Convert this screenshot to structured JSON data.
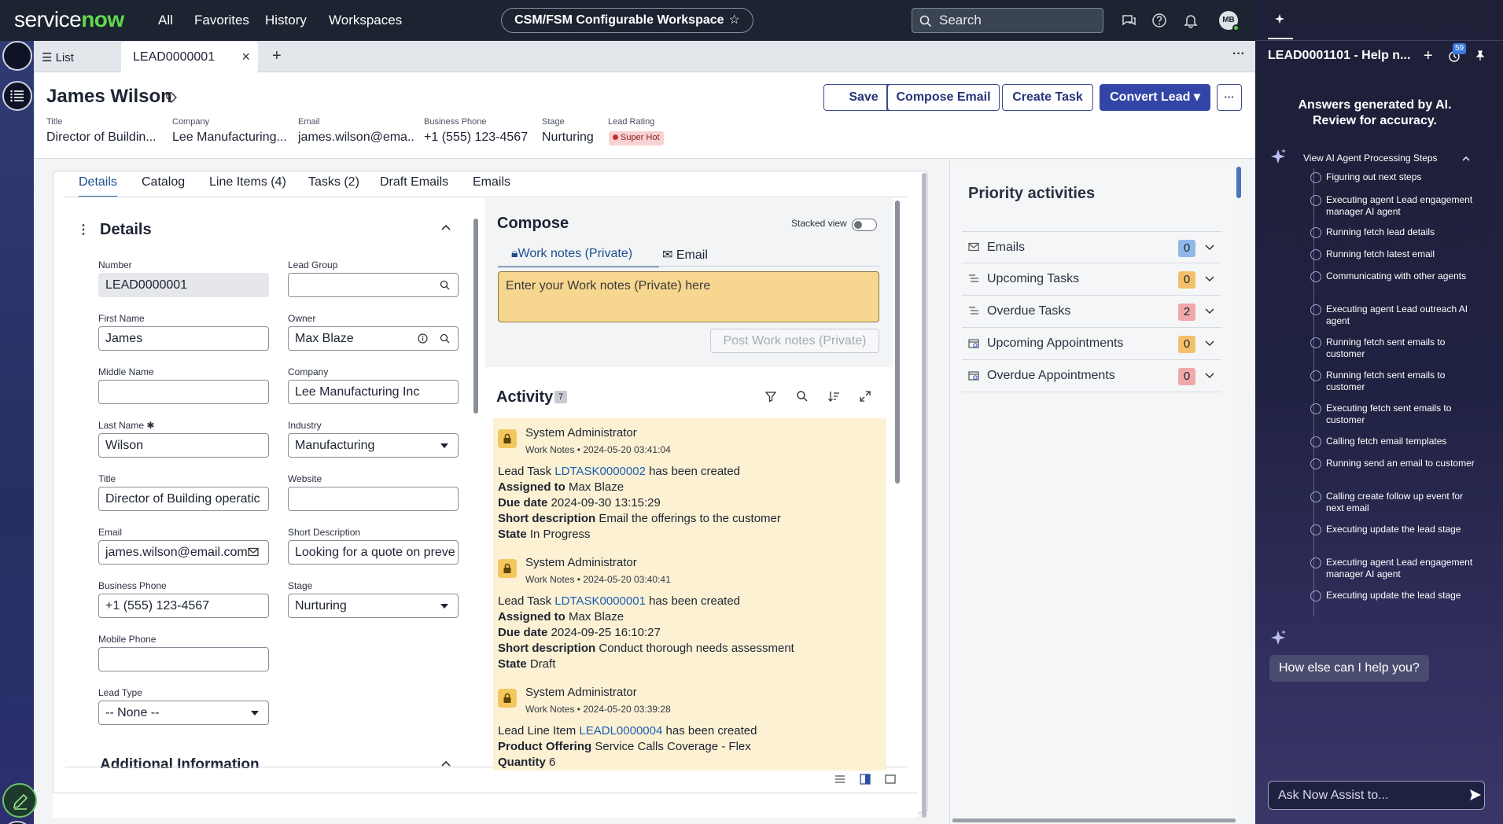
{
  "topnav": {
    "logo_a": "service",
    "logo_b": "now",
    "links": [
      "All",
      "Favorites",
      "History",
      "Workspaces"
    ],
    "workspace": "CSM/FSM Configurable Workspace",
    "search_placeholder": "Search",
    "avatar": "MB"
  },
  "tabs": {
    "list_label": "List",
    "active_tab": "LEAD0000001",
    "close": "×",
    "add": "+"
  },
  "record": {
    "name": "James Wilson",
    "fields": [
      {
        "label": "Title",
        "value": "Director of Buildin..."
      },
      {
        "label": "Company",
        "value": "Lee Manufacturing..."
      },
      {
        "label": "Email",
        "value": "james.wilson@ema..."
      },
      {
        "label": "Business Phone",
        "value": "+1 (555) 123-4567"
      },
      {
        "label": "Stage",
        "value": "Nurturing"
      },
      {
        "label": "Lead Rating",
        "value": "Super Hot"
      }
    ],
    "buttons": {
      "save": "Save",
      "compose": "Compose Email",
      "task": "Create Task",
      "convert": "Convert Lead",
      "more": "···"
    }
  },
  "subtabs": [
    "Details",
    "Catalog",
    "Line Items (4)",
    "Tasks (2)",
    "Draft Emails",
    "Emails"
  ],
  "details": {
    "section": "Details",
    "number_label": "Number",
    "number": "LEAD0000001",
    "lead_group_label": "Lead Group",
    "lead_group": "",
    "first_name_label": "First Name",
    "first_name": "James",
    "owner_label": "Owner",
    "owner": "Max Blaze",
    "middle_name_label": "Middle Name",
    "middle_name": "",
    "company_label": "Company",
    "company": "Lee Manufacturing Inc",
    "last_name_label": "Last Name",
    "last_name": "Wilson",
    "industry_label": "Industry",
    "industry": "Manufacturing",
    "title_label": "Title",
    "title": "Director of Building operatic",
    "website_label": "Website",
    "website": "",
    "email_label": "Email",
    "email": "james.wilson@email.com",
    "short_desc_label": "Short Description",
    "short_desc": "Looking for a quote on preve",
    "phone_label": "Business Phone",
    "phone": "+1 (555) 123-4567",
    "stage_label": "Stage",
    "stage": "Nurturing",
    "mobile_label": "Mobile Phone",
    "mobile": "",
    "lead_type_label": "Lead Type",
    "lead_type": "-- None --",
    "additional": "Additional Information"
  },
  "compose": {
    "title": "Compose",
    "stacked": "Stacked view",
    "tab_worknotes": "Work notes (Private)",
    "tab_email": "Email",
    "placeholder": "Enter your Work notes (Private) here",
    "post": "Post Work notes (Private)"
  },
  "activity": {
    "title": "Activity",
    "count": "7",
    "entries": [
      {
        "author": "System Administrator",
        "type": "Work Notes",
        "time": "2024-05-20 03:41:04",
        "pre": "Lead Task ",
        "link": "LDTASK0000002",
        "post": " has been created",
        "assigned": "Max Blaze",
        "due": "2024-09-30 13:15:29",
        "desc": "Email the offerings to the customer",
        "state": "In Progress"
      },
      {
        "author": "System Administrator",
        "type": "Work Notes",
        "time": "2024-05-20 03:40:41",
        "pre": "Lead Task ",
        "link": "LDTASK0000001",
        "post": " has been created",
        "assigned": "Max Blaze",
        "due": "2024-09-25 16:10:27",
        "desc": "Conduct thorough needs assessment",
        "state": "Draft"
      },
      {
        "author": "System Administrator",
        "type": "Work Notes",
        "time": "2024-05-20 03:39:28",
        "pre": "Lead Line Item ",
        "link": "LEADL0000004",
        "post": " has been created",
        "offering": "Service Calls Coverage - Flex",
        "quantity": "6"
      }
    ],
    "labels": {
      "assigned": "Assigned to",
      "due": "Due date",
      "desc": "Short description",
      "state": "State",
      "offering": "Product Offering",
      "quantity": "Quantity"
    }
  },
  "priority": {
    "title": "Priority activities",
    "rows": [
      {
        "label": "Emails",
        "count": "0",
        "color": "#8fb9e8"
      },
      {
        "label": "Upcoming Tasks",
        "count": "0",
        "color": "#f3c06a"
      },
      {
        "label": "Overdue Tasks",
        "count": "2",
        "color": "#f1a8a8"
      },
      {
        "label": "Upcoming Appointments",
        "count": "0",
        "color": "#f3c06a"
      },
      {
        "label": "Overdue Appointments",
        "count": "0",
        "color": "#f1a8a8"
      }
    ]
  },
  "ai": {
    "title": "LEAD0001101 - Help n...",
    "badge": "59",
    "warning": "Answers generated by AI. Review for accuracy.",
    "steps_title": "View AI Agent Processing Steps",
    "steps": [
      "Figuring out next steps",
      "Executing agent Lead engagement manager AI agent",
      "Running fetch lead details",
      "Running fetch latest email",
      "Communicating with other agents",
      "Executing agent Lead outreach AI agent",
      "Running fetch sent emails to customer",
      "Running fetch sent emails to customer",
      "Executing fetch sent emails to customer",
      "Calling fetch email templates",
      "Running send an email to customer",
      "Calling create follow up event for next email",
      "Executing update the lead stage",
      "Executing agent Lead engagement manager AI agent",
      "Executing update the lead stage"
    ],
    "help": "How else can I help you?",
    "input_placeholder": "Ask Now Assist to..."
  }
}
